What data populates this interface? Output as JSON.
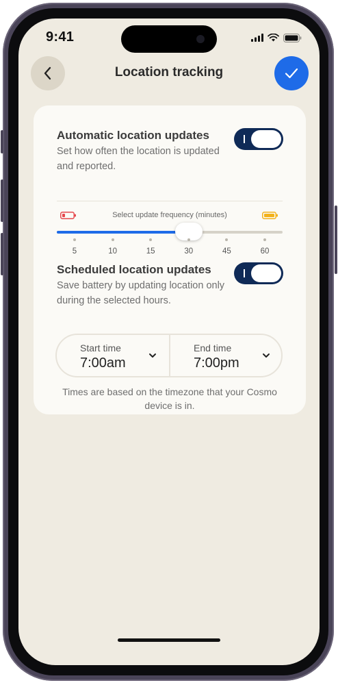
{
  "status_bar": {
    "time": "9:41",
    "icons": [
      "cellular-signal-icon",
      "wifi-icon",
      "battery-icon"
    ]
  },
  "header": {
    "title": "Location tracking",
    "back_icon": "chevron-left-icon",
    "confirm_icon": "checkmark-icon"
  },
  "automatic_updates": {
    "title": "Automatic location updates",
    "description": "Set how often the location is updated and reported.",
    "enabled": true
  },
  "frequency_slider": {
    "label": "Select update frequency (minutes)",
    "ticks": [
      "5",
      "10",
      "15",
      "30",
      "45",
      "60"
    ],
    "selected": "30",
    "left_icon": "battery-low-icon",
    "right_icon": "battery-full-icon"
  },
  "scheduled_updates": {
    "title": "Scheduled location updates",
    "description": "Save battery by updating location only during the selected hours.",
    "enabled": true
  },
  "schedule": {
    "start_label": "Start time",
    "start_value": "7:00am",
    "end_label": "End time",
    "end_value": "7:00pm",
    "note": "Times are based on the timezone that your Cosmo device is in."
  },
  "colors": {
    "background": "#efebe1",
    "card": "#fbfaf6",
    "accent_blue": "#1e6be8",
    "toggle_navy": "#0f2a57",
    "battery_low": "#e5484d",
    "battery_full": "#f2b21c"
  }
}
